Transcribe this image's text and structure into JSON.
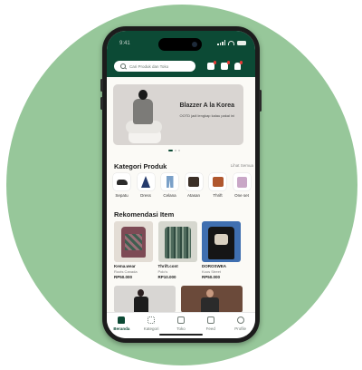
{
  "status_bar": {
    "time": "9:41"
  },
  "header": {
    "search_placeholder": "Cari Produk dan Toko",
    "icons": [
      "chat-icon",
      "cart-icon",
      "bell-icon"
    ]
  },
  "banner": {
    "title": "Blazzer A la Korea",
    "subtitle": "OOTD jadi lengkap kalau pakai ini",
    "slide_index": 1,
    "slide_count": 3
  },
  "categories": {
    "title": "Kategori Produk",
    "see_all": "Lihat Semua",
    "items": [
      {
        "label": "Sepatu",
        "icon": "shoe-icon"
      },
      {
        "label": "Dress",
        "icon": "dress-icon"
      },
      {
        "label": "Celana",
        "icon": "pants-icon"
      },
      {
        "label": "Atasan",
        "icon": "jacket-icon"
      },
      {
        "label": "Thrift",
        "icon": "thrift-icon"
      },
      {
        "label": "One set",
        "icon": "set-icon"
      }
    ]
  },
  "recommendations": {
    "title": "Rekomendasi Item",
    "items": [
      {
        "brand": "Kema.wear",
        "location": "Roots Canada",
        "price": "RP50.000"
      },
      {
        "brand": "Thrift.cont",
        "location": "Polo's",
        "price": "RP10.000"
      },
      {
        "brand": "DOROSWEA",
        "location": "Koos Street",
        "price": "RP50.000"
      }
    ]
  },
  "bottom_nav": {
    "items": [
      {
        "label": "Beranda",
        "icon": "home-icon",
        "active": true
      },
      {
        "label": "Kategori",
        "icon": "grid-icon",
        "active": false
      },
      {
        "label": "Toko",
        "icon": "store-icon",
        "active": false
      },
      {
        "label": "Feed",
        "icon": "feed-icon",
        "active": false
      },
      {
        "label": "Profile",
        "icon": "profile-icon",
        "active": false
      }
    ]
  },
  "colors": {
    "brand": "#0c4a35",
    "background_circle": "#97c79a",
    "notification": "#e53935"
  }
}
